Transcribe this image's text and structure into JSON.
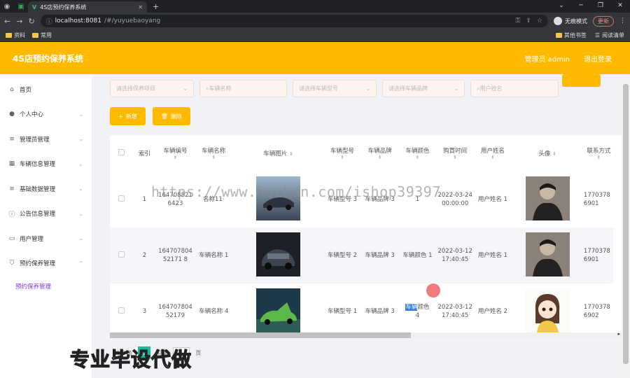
{
  "browser": {
    "tab_title": "4S店预约保养系统",
    "url_host": "localhost:8081",
    "url_path": "/#/yuyuebaoyang",
    "incognito_label": "无痕模式",
    "update_label": "更新",
    "bookmarks": [
      "资料",
      "常用"
    ],
    "bookmarks_right": [
      "其他书签",
      "阅读清单"
    ]
  },
  "header": {
    "title": "4S店预约保养系统",
    "user": "管理员 admin",
    "logout": "退出登录"
  },
  "sidebar": {
    "items": [
      {
        "label": "首页",
        "icon": "home-icon"
      },
      {
        "label": "个人中心",
        "icon": "person-icon"
      },
      {
        "label": "管理员管理",
        "icon": "menu-icon"
      },
      {
        "label": "车辆信息管理",
        "icon": "calendar-icon"
      },
      {
        "label": "基础数据管理",
        "icon": "menu-icon"
      },
      {
        "label": "公告信息管理",
        "icon": "info-icon"
      },
      {
        "label": "用户管理",
        "icon": "monitor-icon"
      },
      {
        "label": "预约保养管理",
        "icon": "shield-icon"
      }
    ],
    "subitem": "预约保养管理"
  },
  "search": {
    "project_placeholder": "请选择保养项目",
    "car_name_placeholder": "车辆名称",
    "car_model_placeholder": "请选择车辆型号",
    "car_brand_placeholder": "请选择车辆品牌",
    "user_name_placeholder": "用户姓名"
  },
  "actions": {
    "add": "新增",
    "delete": "删除"
  },
  "table": {
    "headers": [
      "索引",
      "车辆编号",
      "车辆名称",
      "车辆图片",
      "车辆型号",
      "车辆品牌",
      "车辆颜色",
      "购買时间",
      "用户姓名",
      "头像",
      "联系方式"
    ],
    "rows": [
      {
        "index": "1",
        "code": "1647088216423",
        "name": "名称11·",
        "model": "车辆型号 3",
        "brand": "车辆品牌 3",
        "color": "1",
        "time": "2022-03-24 00:00:00",
        "user": "用户姓名 1",
        "phone": "17703786901"
      },
      {
        "index": "2",
        "code": "16470780452171 8",
        "name": "车辆名称 1",
        "model": "车辆型号 2",
        "brand": "车辆品牌 3",
        "color": "车辆颜色 1",
        "time": "2022-03-12 17:40:45",
        "user": "用户姓名 1",
        "phone": "17703786901"
      },
      {
        "index": "3",
        "code": "16470780452179",
        "name": "车辆名称 4",
        "model": "车辆型号 1",
        "brand": "车辆品牌 3",
        "color_a": "车辆",
        "color_b": "颜色",
        "color_c": "4",
        "time": "2022-03-12 17:40:45",
        "user": "用户姓名 2",
        "phone": "17703786902"
      }
    ]
  },
  "pager": {
    "total": "共 3 条",
    "current": "1",
    "goto": "前往",
    "page_value": "1",
    "page_unit": "页"
  },
  "watermark": "https://www.huzhan.com/ishop39397",
  "overlay": "专业毕设代做"
}
